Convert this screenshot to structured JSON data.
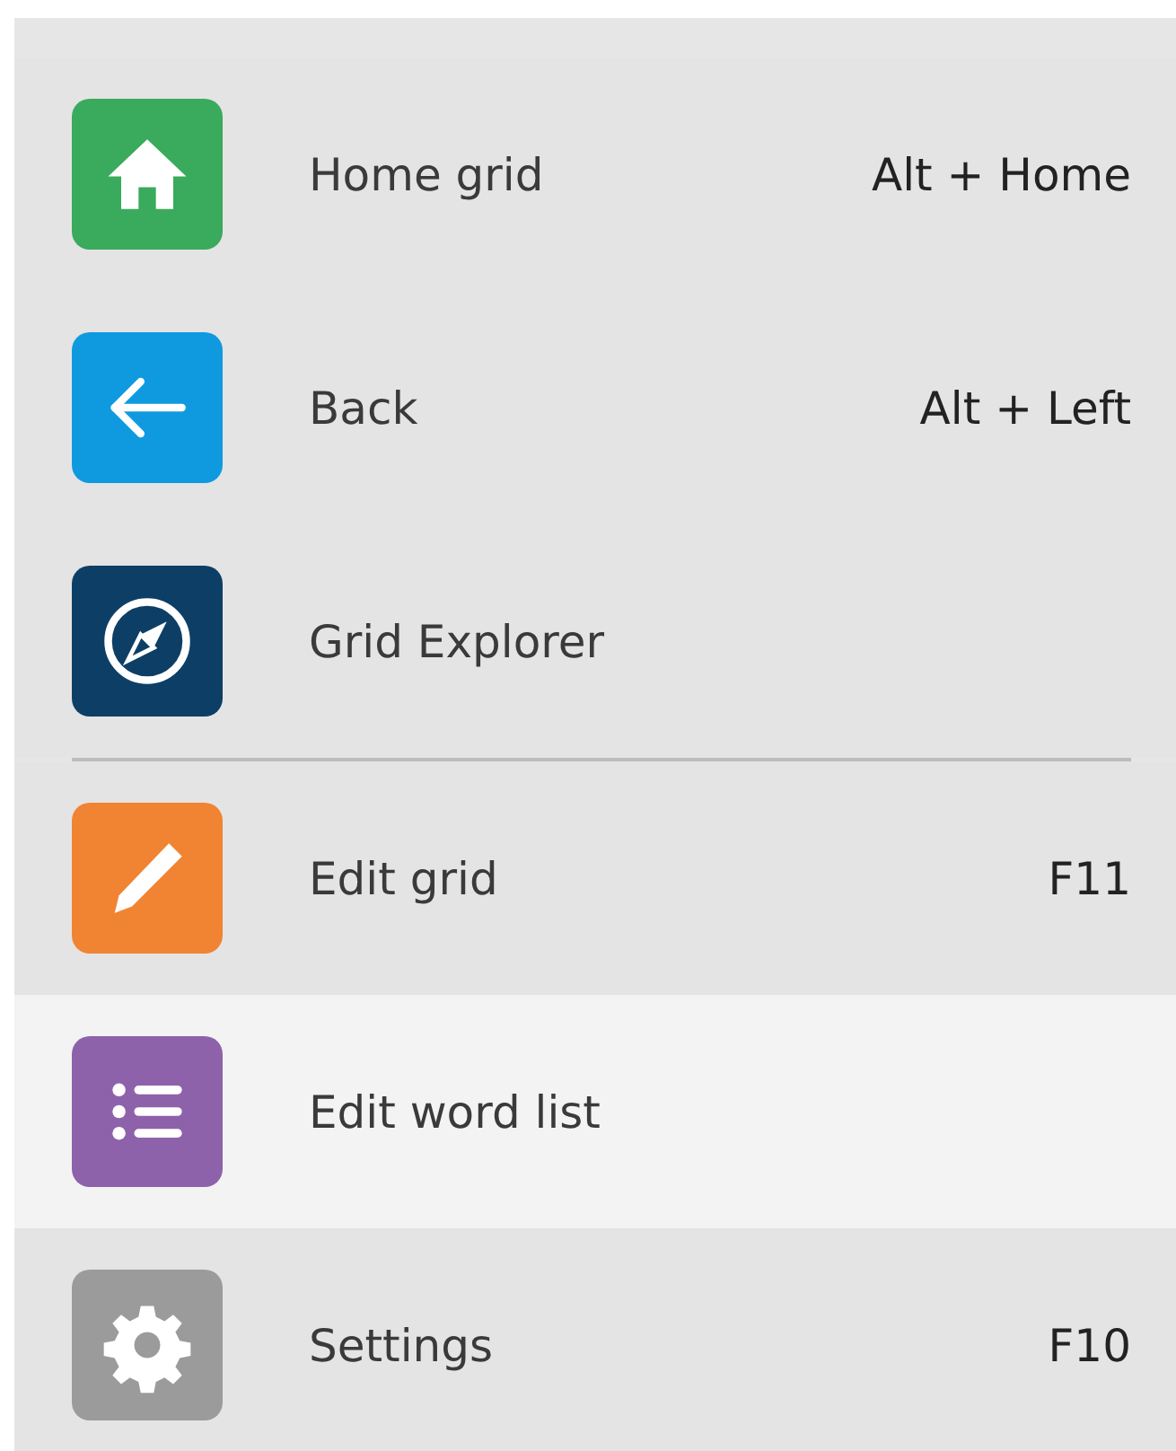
{
  "sections": [
    {
      "items": [
        {
          "label": "Home grid",
          "shortcut": "Alt + Home",
          "selected": false,
          "color": "#3aaa5c"
        },
        {
          "label": "Back",
          "shortcut": "Alt + Left",
          "selected": false,
          "color": "#0f9ae0"
        },
        {
          "label": "Grid Explorer",
          "selected": false,
          "color": "#0d3f66"
        }
      ]
    },
    {
      "items": [
        {
          "label": "Edit grid",
          "shortcut": "F11",
          "selected": false,
          "color": "#f08432"
        },
        {
          "label": "Edit word list",
          "selected": true,
          "color": "#8e62aa"
        },
        {
          "label": "Settings",
          "shortcut": "F10",
          "selected": false,
          "color": "#9b9b9b"
        }
      ]
    }
  ]
}
